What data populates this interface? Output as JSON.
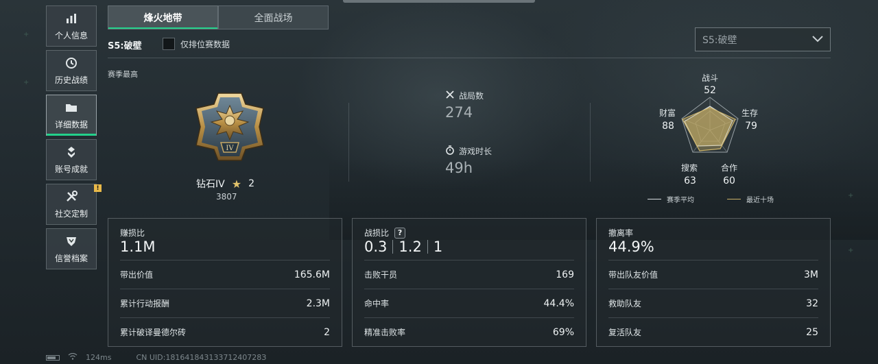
{
  "sidebar": {
    "items": [
      {
        "label": "个人信息",
        "icon": "bar-chart-icon",
        "active": false
      },
      {
        "label": "历史战绩",
        "icon": "clock-icon",
        "active": false
      },
      {
        "label": "详细数据",
        "icon": "folder-icon",
        "active": true
      },
      {
        "label": "账号成就",
        "icon": "medal-icon",
        "active": false
      },
      {
        "label": "社交定制",
        "icon": "tools-icon",
        "active": false,
        "badge": "!"
      },
      {
        "label": "信誉档案",
        "icon": "shield-icon",
        "active": false
      }
    ]
  },
  "tabs": [
    {
      "label": "烽火地带",
      "active": true
    },
    {
      "label": "全面战场",
      "active": false
    }
  ],
  "season": {
    "title": "S5:破壁",
    "ranked_only_label": "仅排位赛数据",
    "dropdown_value": "S5:破壁",
    "best_label": "赛季最高"
  },
  "rank": {
    "name": "钻石IV",
    "stars": "2",
    "score": "3807",
    "emblem_numeral": "IV"
  },
  "mid_stats": {
    "matches_label": "战局数",
    "matches_value": "274",
    "playtime_label": "游戏时长",
    "playtime_value": "49h"
  },
  "radar": {
    "axes": [
      {
        "label": "战斗",
        "value": "52"
      },
      {
        "label": "生存",
        "value": "79"
      },
      {
        "label": "合作",
        "value": "60"
      },
      {
        "label": "搜索",
        "value": "63"
      },
      {
        "label": "财富",
        "value": "88"
      }
    ],
    "legend_season": "赛季平均",
    "legend_recent": "最近十场",
    "season_color": "#d9dfe2",
    "recent_color": "#cdb46a"
  },
  "cards": {
    "profit": {
      "title": "赚损比",
      "value": "1.1M",
      "rows": [
        {
          "k": "带出价值",
          "v": "165.6M"
        },
        {
          "k": "累计行动报酬",
          "v": "2.3M"
        },
        {
          "k": "累计破译曼德尔砖",
          "v": "2"
        }
      ]
    },
    "combat": {
      "title": "战损比",
      "help": "?",
      "ratio": [
        "0.3",
        "1.2",
        "1"
      ],
      "rows": [
        {
          "k": "击败干员",
          "v": "169"
        },
        {
          "k": "命中率",
          "v": "44.4%"
        },
        {
          "k": "精准击败率",
          "v": "69%"
        }
      ]
    },
    "extract": {
      "title": "撤离率",
      "value": "44.9%",
      "rows": [
        {
          "k": "带出队友价值",
          "v": "3M"
        },
        {
          "k": "救助队友",
          "v": "32"
        },
        {
          "k": "复活队友",
          "v": "25"
        }
      ]
    }
  },
  "footer": {
    "ping": "124ms",
    "uid": "CN UID:18164184313371240728З"
  },
  "accent_color": "#23d18b"
}
